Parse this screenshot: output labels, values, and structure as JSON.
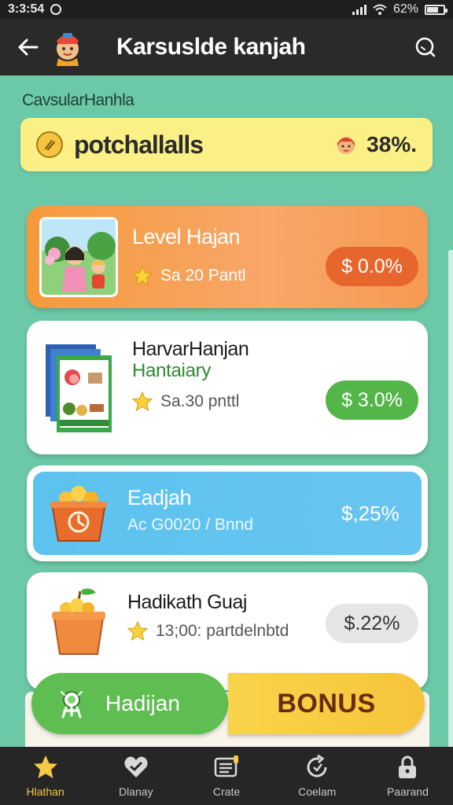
{
  "status_bar": {
    "time": "3:3:54",
    "battery": "62%",
    "battery_level": 0.62
  },
  "app_bar": {
    "title": "Karsuslde kanjah"
  },
  "section": {
    "label": "CavsularHanhla"
  },
  "promo": {
    "text": "potchallalls",
    "value": "38%."
  },
  "cards": [
    {
      "title": "Level Hajan",
      "meta": "Sa 20 Pantl",
      "price": "$ 0.0%"
    },
    {
      "title": "HarvarHanjan",
      "subtitle": "Hantaiary",
      "meta": "Sa.30 pnttl",
      "price": "$ 3.0%"
    },
    {
      "title": "Eadjah",
      "meta": "Ac G0020 / Bnnd",
      "price": "$,25%"
    },
    {
      "title": "Hadikath Guaj",
      "meta": "13;00: partdelnbtd",
      "price": "$.22%"
    }
  ],
  "actions": {
    "left_label": "Hadijan",
    "right_label": "BONUS"
  },
  "tabs": [
    {
      "label": "Hlathan",
      "icon": "star-icon",
      "active": true
    },
    {
      "label": "Dlanay",
      "icon": "heart-icon",
      "active": false
    },
    {
      "label": "Crate",
      "icon": "list-icon",
      "active": false
    },
    {
      "label": "Coelam",
      "icon": "refresh-icon",
      "active": false
    },
    {
      "label": "Paarand",
      "icon": "lock-icon",
      "active": false
    }
  ],
  "colors": {
    "background": "#6cc9a8",
    "app_bar": "#2a2a2a",
    "banner": "#fbf086",
    "card_orange": "#f59a3a",
    "card_blue": "#5cc3ee",
    "pill_green": "#54b549",
    "bonus": "#f8d44a",
    "tab_active": "#f6c945"
  }
}
